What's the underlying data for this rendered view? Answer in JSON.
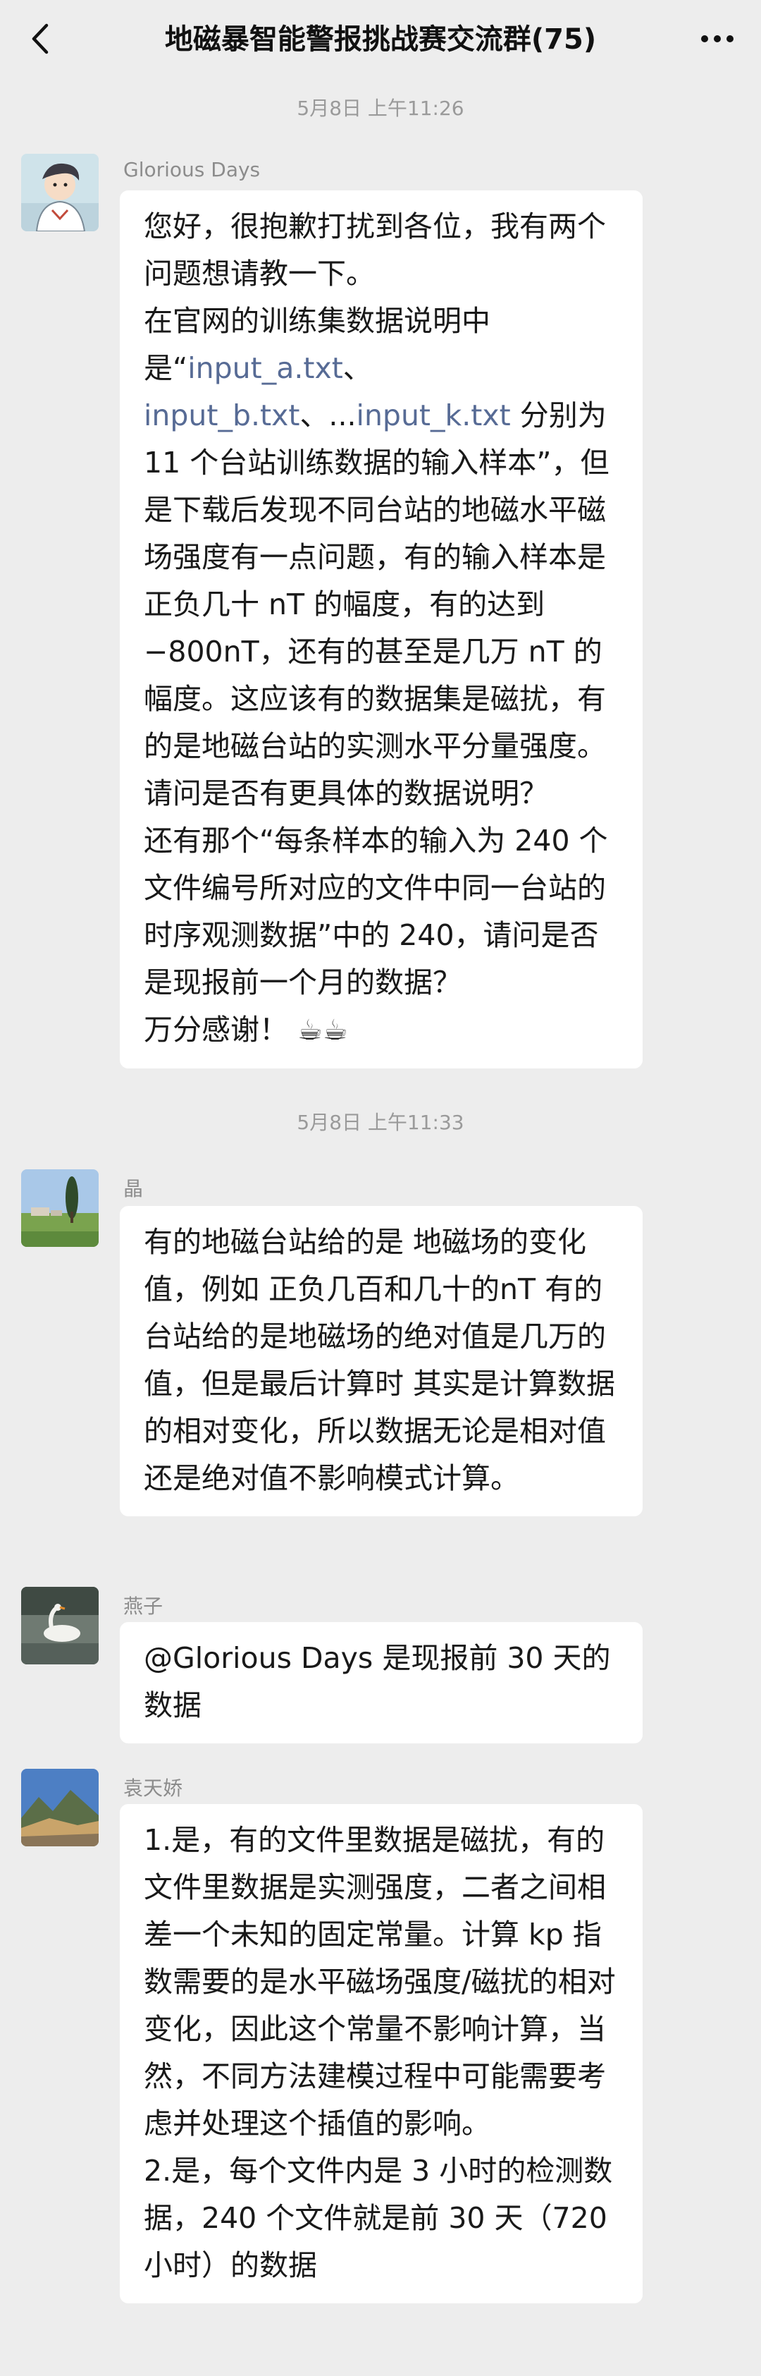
{
  "header": {
    "title": "地磁暴智能警报挑战赛交流群(75)"
  },
  "timestamps": {
    "t1": "5月8日 上午11:26",
    "t2": "5月8日 上午11:33"
  },
  "messages": [
    {
      "sender": "Glorious Days",
      "lines": {
        "l1": "您好，很抱歉打扰到各位，我有两个问题想请教一下。",
        "l2a": "在官网的训练集数据说明中是“",
        "link1": "input_a.txt",
        "sep1": "、",
        "link2": "input_b.txt",
        "sep2": "、...",
        "link3": "input_k.txt",
        "l2b": " 分别为 11 个台站训练数据的输入样本”，但是下载后发现不同台站的地磁水平磁场强度有一点问题，有的输入样本是正负几十 nT 的幅度，有的达到−800nT，还有的甚至是几万 nT 的幅度。这应该有的数据集是磁扰，有的是地磁台站的实测水平分量强度。请问是否有更具体的数据说明？",
        "l3": "还有那个“每条样本的输入为 240 个文件编号所对应的文件中同一台站的时序观测数据”中的 240，请问是否是现报前一个月的数据？",
        "l4": "万分感谢！",
        "emoji": "☕☕"
      }
    },
    {
      "sender": "晶",
      "text": "有的地磁台站给的是 地磁场的变化值，例如 正负几百和几十的nT 有的台站给的是地磁场的绝对值是几万的值，但是最后计算时 其实是计算数据的相对变化，所以数据无论是相对值还是绝对值不影响模式计算。"
    },
    {
      "sender": "燕子",
      "mention": "@Glorious Days",
      "text": " 是现报前 30 天的数据"
    },
    {
      "sender": "袁天娇",
      "p1": "1.是，有的文件里数据是磁扰，有的文件里数据是实测强度，二者之间相差一个未知的固定常量。计算 kp 指数需要的是水平磁场强度/磁扰的相对变化，因此这个常量不影响计算，当然，不同方法建模过程中可能需要考虑并处理这个插值的影响。",
      "p2": "2.是，每个文件内是 3 小时的检测数据，240 个文件就是前 30 天（720 小时）的数据"
    }
  ]
}
